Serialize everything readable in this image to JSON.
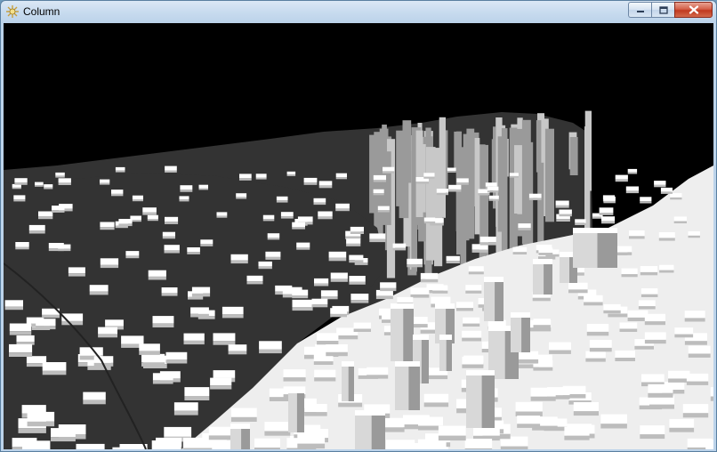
{
  "window": {
    "title": "Column"
  },
  "titlebar": {
    "icons": {
      "app": "gear-sparkle-icon",
      "minimize": "minimize-icon",
      "maximize": "maximize-icon",
      "close": "close-icon"
    }
  },
  "scene": {
    "description_colors": {
      "sky": "#000000",
      "terrain_dark": "#333333",
      "terrain_light": "#f2f2f2",
      "block_side": "#9a9a9a",
      "block_top": "#ffffff"
    }
  }
}
